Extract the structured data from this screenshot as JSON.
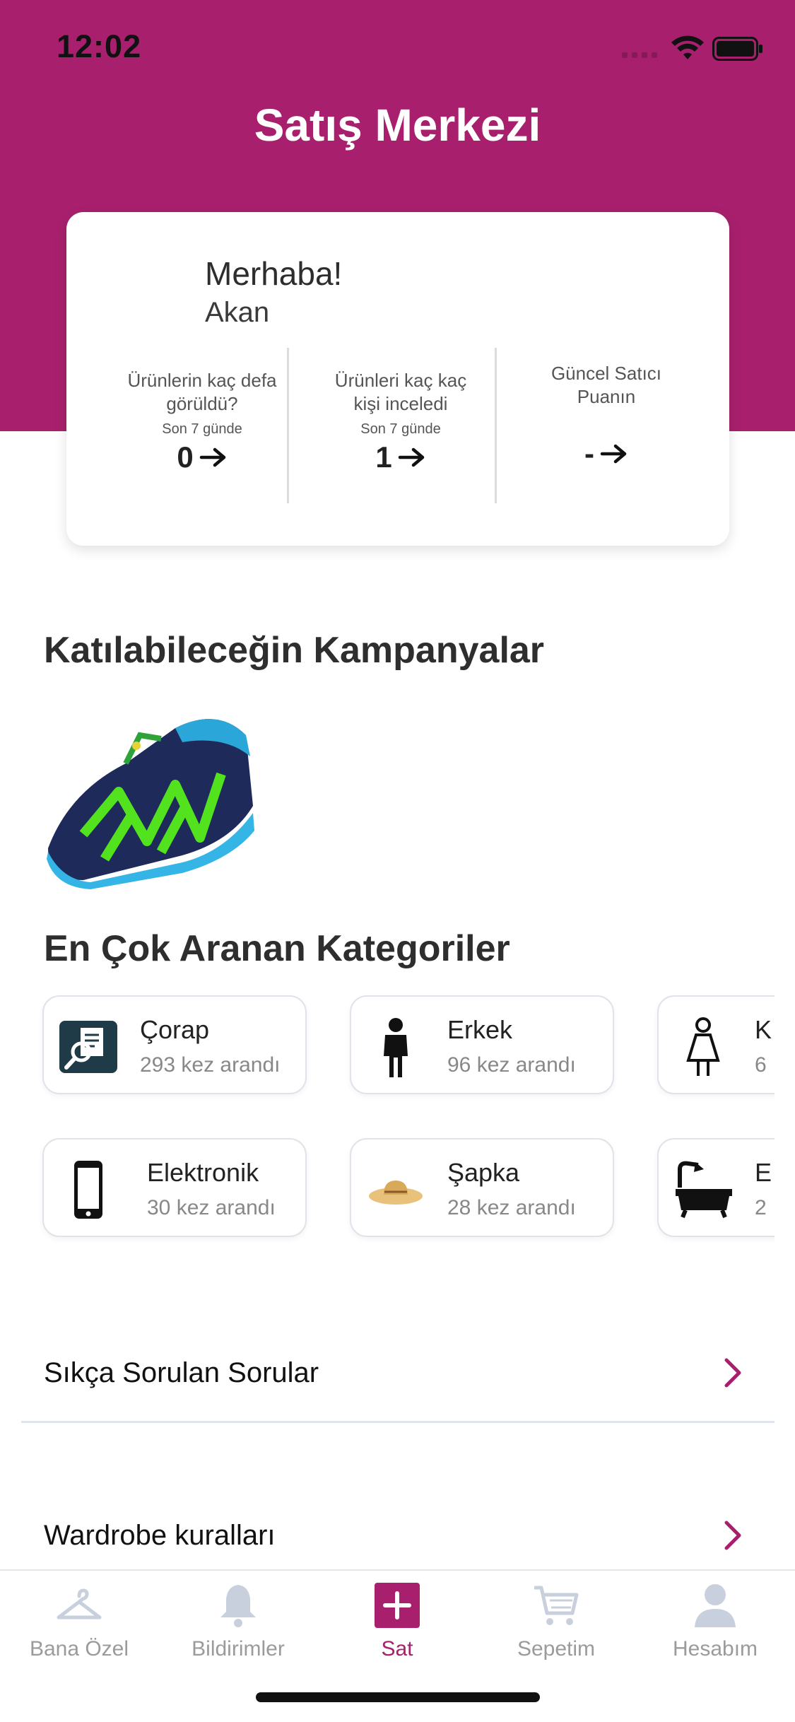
{
  "status_bar": {
    "time": "12:02"
  },
  "header": {
    "title": "Satış Merkezi",
    "bg_color": "#a8206d"
  },
  "summary": {
    "greeting": "Merhaba!",
    "user_name": "Akan",
    "metrics": [
      {
        "question": "Ürünlerin kaç defa görüldü?",
        "period": "Son 7 günde",
        "value": "0"
      },
      {
        "question": "Ürünleri kaç kaç kişi inceledi",
        "period": "Son 7 günde",
        "value": "1"
      },
      {
        "question": "Güncel Satıcı Puanın",
        "period": "",
        "value": "-"
      }
    ]
  },
  "campaigns": {
    "title": "Katılabileceğin Kampanyalar",
    "items": [
      {
        "icon": "sneaker-image"
      }
    ]
  },
  "categories": {
    "title": "En Çok Aranan Kategoriler",
    "items": [
      {
        "name": "Çorap",
        "count": "293 kez arandı",
        "icon": "document-search-icon"
      },
      {
        "name": "Erkek",
        "count": "96 kez arandı",
        "icon": "man-icon"
      },
      {
        "name": "K",
        "count": "6",
        "icon": "woman-icon"
      },
      {
        "name": "Elektronik",
        "count": "30 kez arandı",
        "icon": "phone-icon"
      },
      {
        "name": "Şapka",
        "count": "28 kez arandı",
        "icon": "hat-icon"
      },
      {
        "name": "E",
        "count": "2",
        "icon": "bathtub-icon"
      }
    ]
  },
  "links": [
    {
      "label": "Sıkça Sorulan Sorular"
    },
    {
      "label": "Wardrobe kuralları"
    }
  ],
  "tabbar": {
    "tabs": [
      {
        "label": "Bana Özel",
        "icon": "hanger-icon"
      },
      {
        "label": "Bildirimler",
        "icon": "bell-icon"
      },
      {
        "label": "Sat",
        "icon": "plus-icon",
        "active": true
      },
      {
        "label": "Sepetim",
        "icon": "cart-icon"
      },
      {
        "label": "Hesabım",
        "icon": "user-icon"
      }
    ]
  }
}
